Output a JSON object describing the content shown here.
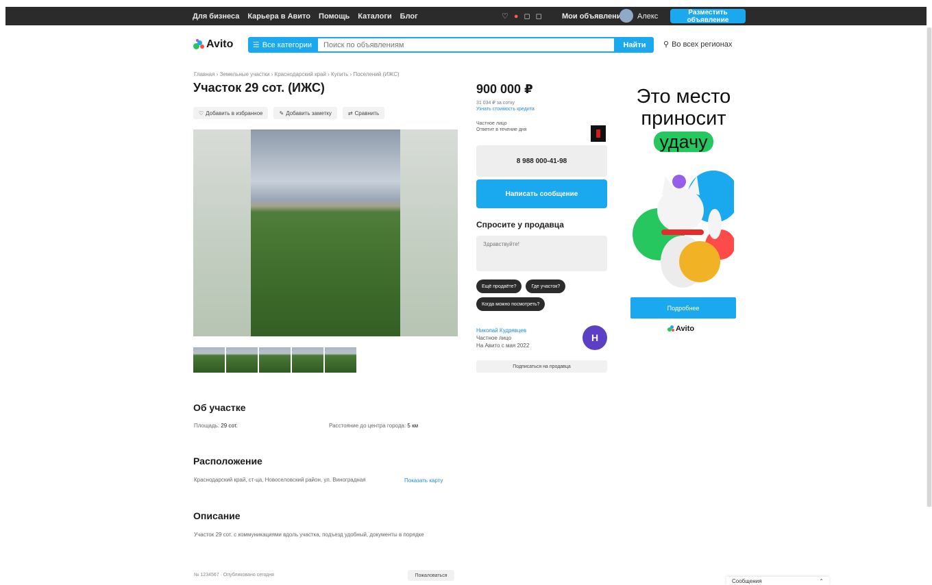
{
  "topbar": {
    "nav": [
      "Для бизнеса",
      "Карьера в Авито",
      "Помощь",
      "Каталоги",
      "Блог"
    ],
    "icons": [
      "heart-icon",
      "cart-icon",
      "bell-icon",
      "chat-icon"
    ],
    "my_ads": "Мои объявления",
    "user_name": "Алекс",
    "post_ad": "Разместить объявление"
  },
  "header": {
    "logo": "Avito",
    "categories_btn": "Все категории",
    "search_placeholder": "Поиск по объявлениям",
    "find_btn": "Найти",
    "region": "Во всех регионах"
  },
  "listing": {
    "breadcrumb": "Главная › Земельные участки › Краснодарский край › Купить › Поселений (ИЖС)",
    "title": "Участок 29 сот. (ИЖС)",
    "actions": [
      "Добавить в избранное",
      "Добавить заметку",
      "Сравнить"
    ],
    "thumb_count": 5
  },
  "about": {
    "heading": "Об участке",
    "area_label": "Площадь:",
    "area_value": "29 сот.",
    "distance_label": "Расстояние до центра города:",
    "distance_value": "5 км"
  },
  "location": {
    "heading": "Расположение",
    "address": "Краснодарский край, ст-ца, Новоселовский район, ул. Виноградная",
    "map_link": "Показать карту"
  },
  "description": {
    "heading": "Описание",
    "text": "Участок 29 сот. с коммуникациями вдоль участка, подъезд удобный, документы в порядке"
  },
  "footer": {
    "note": "№ 1234567 · Опубликовано сегодня",
    "report": "Пожаловаться"
  },
  "sidebar": {
    "price": "900 000 ₽",
    "price_sub1": "31 034 ₽ за сотку",
    "price_sub2": "Узнать стоимость кредита",
    "seller_mini1": "Частное лицо",
    "seller_mini2": "Ответит в течение дня",
    "phone": "8 988 000-41-98",
    "write_msg": "Написать сообщение",
    "ask_heading": "Спросите у продавца",
    "ask_placeholder": "Здравствуйте!",
    "chips": [
      "Ещё продаёте?",
      "Где участок?",
      "Когда можно посмотреть?"
    ],
    "seller_name": "Николай Кудрявцев",
    "seller_type": "Частное лицо",
    "seller_since": "На Авито с мая 2022",
    "seller_initial": "Н",
    "subscribe": "Подписаться на продавца"
  },
  "ad": {
    "line1": "Это место",
    "line2": "приносит",
    "highlight": "удачу",
    "button": "Подробнее",
    "logo": "Avito"
  },
  "messages_widget": {
    "label": "Сообщения"
  },
  "colors": {
    "accent": "#1aa8ee",
    "topbar": "#2b2b2b",
    "ad_green": "#27c760",
    "seller_avatar": "#5b3fc4"
  }
}
